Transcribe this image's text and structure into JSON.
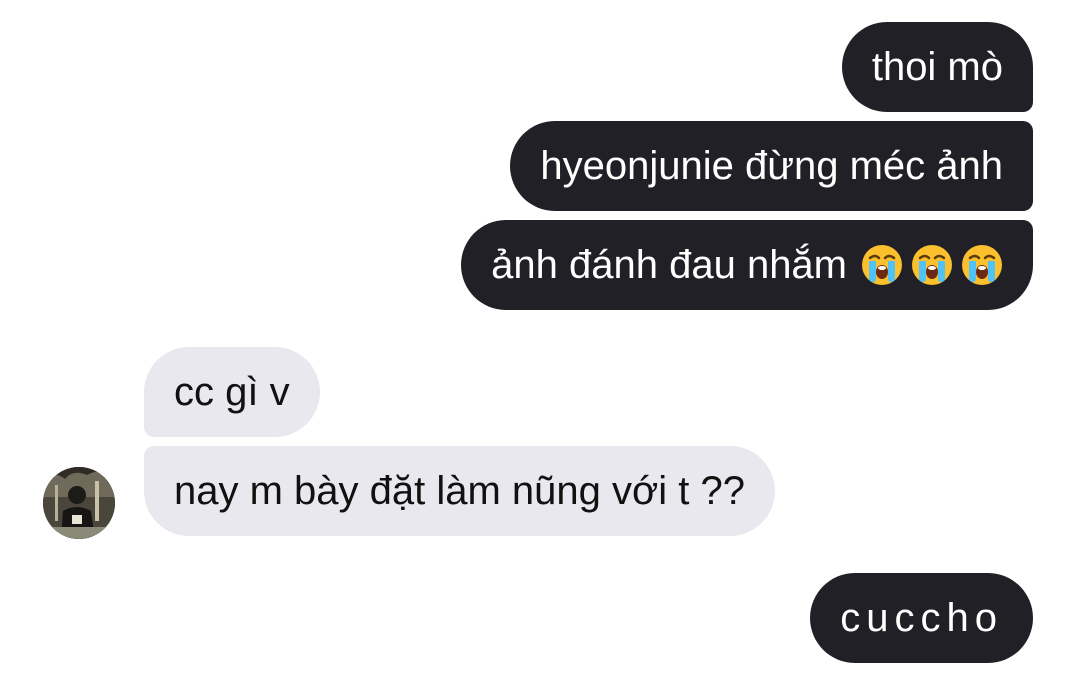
{
  "messages": [
    {
      "direction": "outgoing",
      "text": "thoi mò"
    },
    {
      "direction": "outgoing",
      "text": "hyeonjunie đừng méc ảnh"
    },
    {
      "direction": "outgoing",
      "text": "ảnh đánh đau nhắm",
      "emoji": [
        "loudly-crying-face-icon",
        "loudly-crying-face-icon",
        "loudly-crying-face-icon"
      ]
    },
    {
      "direction": "incoming",
      "text": "cc gì v"
    },
    {
      "direction": "incoming",
      "text": "nay m bày đặt làm nũng với t ??"
    },
    {
      "direction": "outgoing",
      "text": "cuccho"
    }
  ],
  "colors": {
    "outgoing_bubble": "#222027",
    "incoming_bubble": "#e9e8ee",
    "outgoing_text": "#ffffff",
    "incoming_text": "#111111",
    "background": "#ffffff"
  }
}
